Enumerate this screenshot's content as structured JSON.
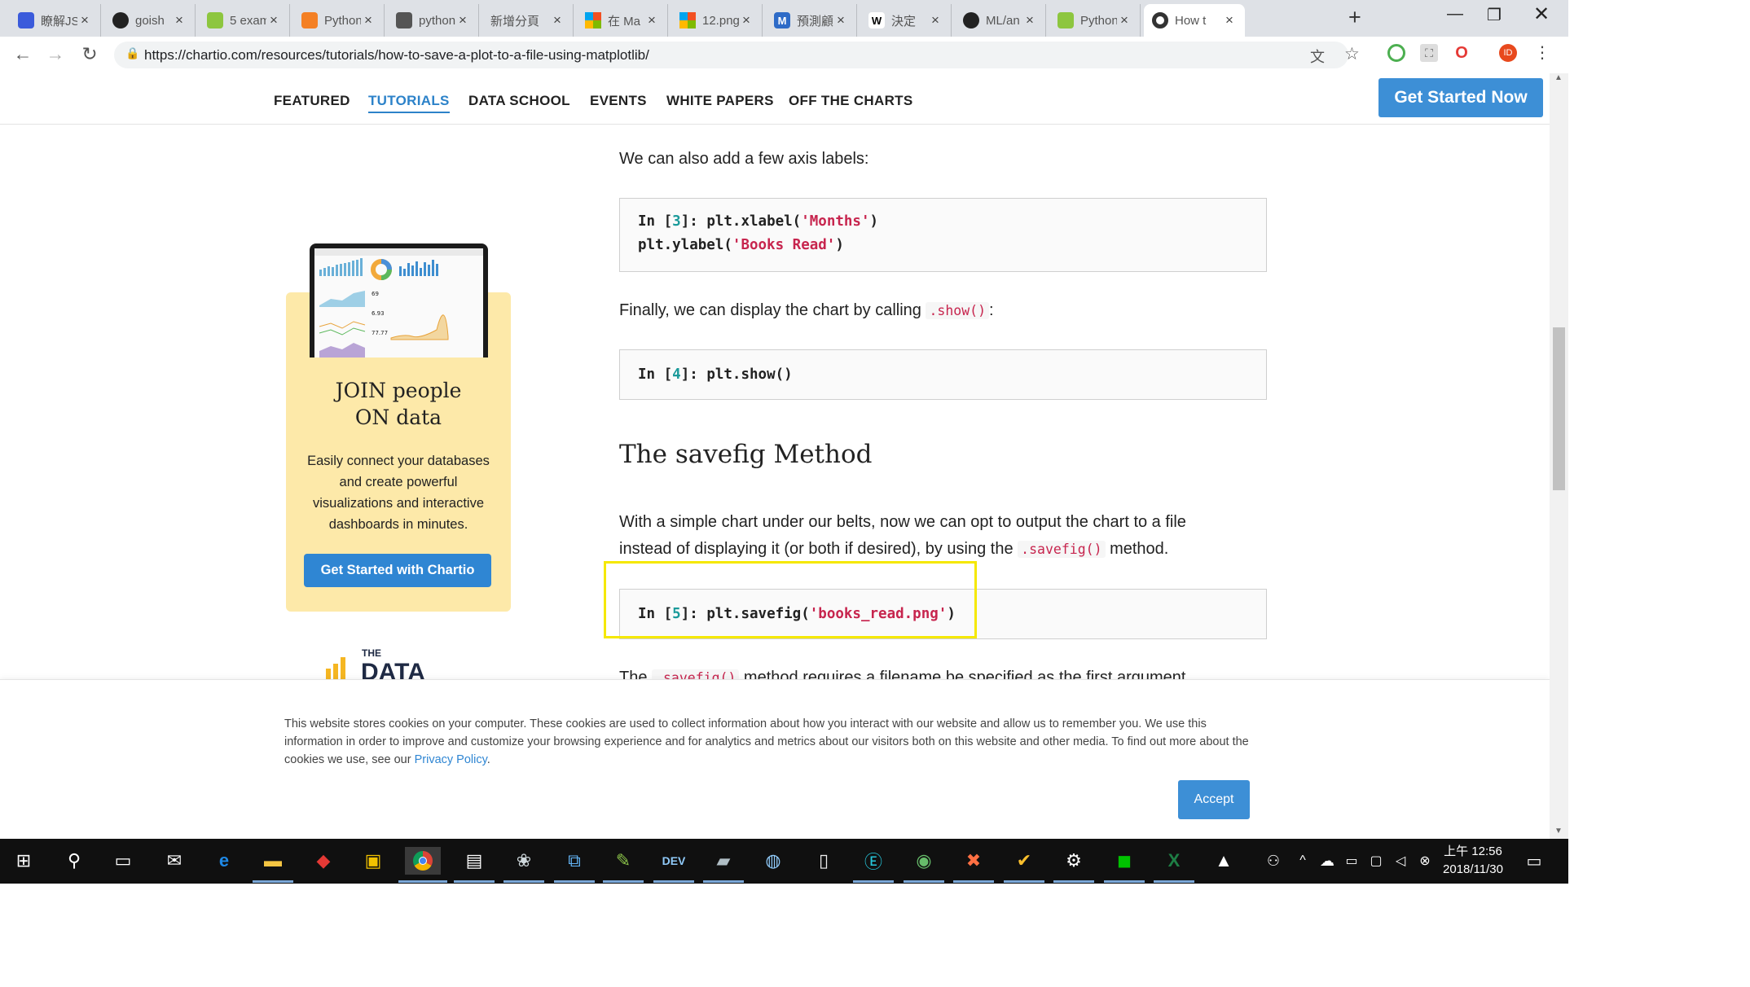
{
  "browser": {
    "tabs": [
      {
        "label": "瞭解JS",
        "color": "#3b5bdb",
        "icon": "doc"
      },
      {
        "label": "goish",
        "color": "#222222",
        "icon": "github"
      },
      {
        "label": "5 exam",
        "color": "#8dc63f",
        "icon": "leaf"
      },
      {
        "label": "Python",
        "color": "#f48024",
        "icon": "stack"
      },
      {
        "label": "python",
        "color": "#555555",
        "icon": "fork"
      },
      {
        "label": "新增分頁",
        "color": "",
        "icon": ""
      },
      {
        "label": "在 Ma",
        "color": "#f25022",
        "icon": "windows"
      },
      {
        "label": "12.png",
        "color": "#f25022",
        "icon": "windows"
      },
      {
        "label": "預測顧",
        "color": "#2e6bc7",
        "icon": "m"
      },
      {
        "label": "決定",
        "color": "#000000",
        "icon": "w"
      },
      {
        "label": "ML/an",
        "color": "#222222",
        "icon": "github"
      },
      {
        "label": "Python",
        "color": "#8dc63f",
        "icon": "leaf"
      },
      {
        "label": "How t",
        "color": "#333333",
        "icon": "chartio"
      }
    ],
    "url": "https://chartio.com/resources/tutorials/how-to-save-a-plot-to-a-file-using-matplotlib/"
  },
  "site_nav": {
    "items": [
      "FEATURED",
      "TUTORIALS",
      "DATA SCHOOL",
      "EVENTS",
      "WHITE PAPERS",
      "OFF THE CHARTS"
    ],
    "active": "TUTORIALS",
    "cta": "Get Started Now"
  },
  "sidebar": {
    "title_line1": "JOIN people",
    "title_line2": "ON data",
    "body": "Easily connect your databases and create powerful visualizations and interactive dashboards in minutes.",
    "button": "Get Started with Chartio",
    "logo_text_small": "THE",
    "logo_text_big": "DATA",
    "mini_values": [
      "69",
      "6.93",
      "77.77"
    ]
  },
  "article": {
    "p1": "We can also add a few axis labels:",
    "code1": {
      "prompt": "In [",
      "num": "3",
      "close": "]: ",
      "line1_pre": "plt.xlabel(",
      "line1_str": "'Months'",
      "line1_post": ")",
      "line2_pre": "plt.ylabel(",
      "line2_str": "'Books Read'",
      "line2_post": ")"
    },
    "p2_pre": "Finally, we can display the chart by calling ",
    "p2_code": ".show()",
    "p2_post": ":",
    "code2": {
      "prompt": "In [",
      "num": "4",
      "close": "]: ",
      "body": "plt.show()"
    },
    "heading": "The savefig Method",
    "p3_line1": "With a simple chart under our belts, now we can opt to output the chart to a file",
    "p3_line2_pre": "instead of displaying it (or both if desired), by using the ",
    "p3_code": ".savefig()",
    "p3_post": " method.",
    "code3": {
      "prompt": "In [",
      "num": "5",
      "close": "]: ",
      "pre": "plt.savefig(",
      "str": "'books_read.png'",
      "post": ")"
    },
    "p4_pre": "The ",
    "p4_code": ".savefig()",
    "p4_post": " method requires a filename be specified as the first argument."
  },
  "cookie": {
    "text": "This website stores cookies on your computer. These cookies are used to collect information about how you interact with our website and allow us to remember you. We use this information in order to improve and customize your browsing experience and for analytics and metrics about our visitors both on this website and other media. To find out more about the cookies we use, see our ",
    "link": "Privacy Policy",
    "end": ".",
    "accept": "Accept"
  },
  "taskbar": {
    "time": "上午 12:56",
    "date": "2018/11/30"
  },
  "colors": {
    "accent": "#3d8fd6",
    "highlight": "#f5e800",
    "promo_bg": "#fde9a9"
  }
}
